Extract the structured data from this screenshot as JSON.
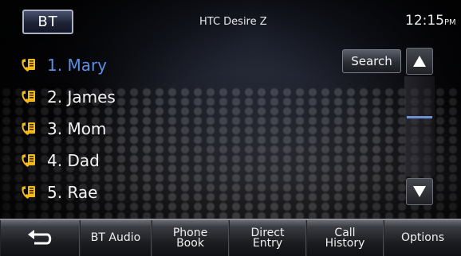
{
  "header": {
    "bt_label": "BT",
    "device_name": "HTC Desire Z",
    "time": "12:15",
    "ampm": "PM"
  },
  "contacts": [
    {
      "label": "1. Mary",
      "selected": true
    },
    {
      "label": "2. James"
    },
    {
      "label": "3. Mom"
    },
    {
      "label": "4. Dad"
    },
    {
      "label": "5. Rae"
    }
  ],
  "search_label": "Search",
  "icons": {
    "contact": "phone-book-icon",
    "back": "back-arrow-icon",
    "scroll_up": "triangle-up-icon",
    "scroll_down": "triangle-down-icon"
  },
  "colors": {
    "selected_text": "#5d8fe6",
    "phone_icon": "#f2b81c",
    "scroll_thumb": "#6f92d6"
  },
  "bottom_tabs": {
    "bt_audio": "BT Audio",
    "phone_book": "Phone\nBook",
    "direct_entry": "Direct\nEntry",
    "call_history": "Call\nHistory",
    "options": "Options"
  }
}
